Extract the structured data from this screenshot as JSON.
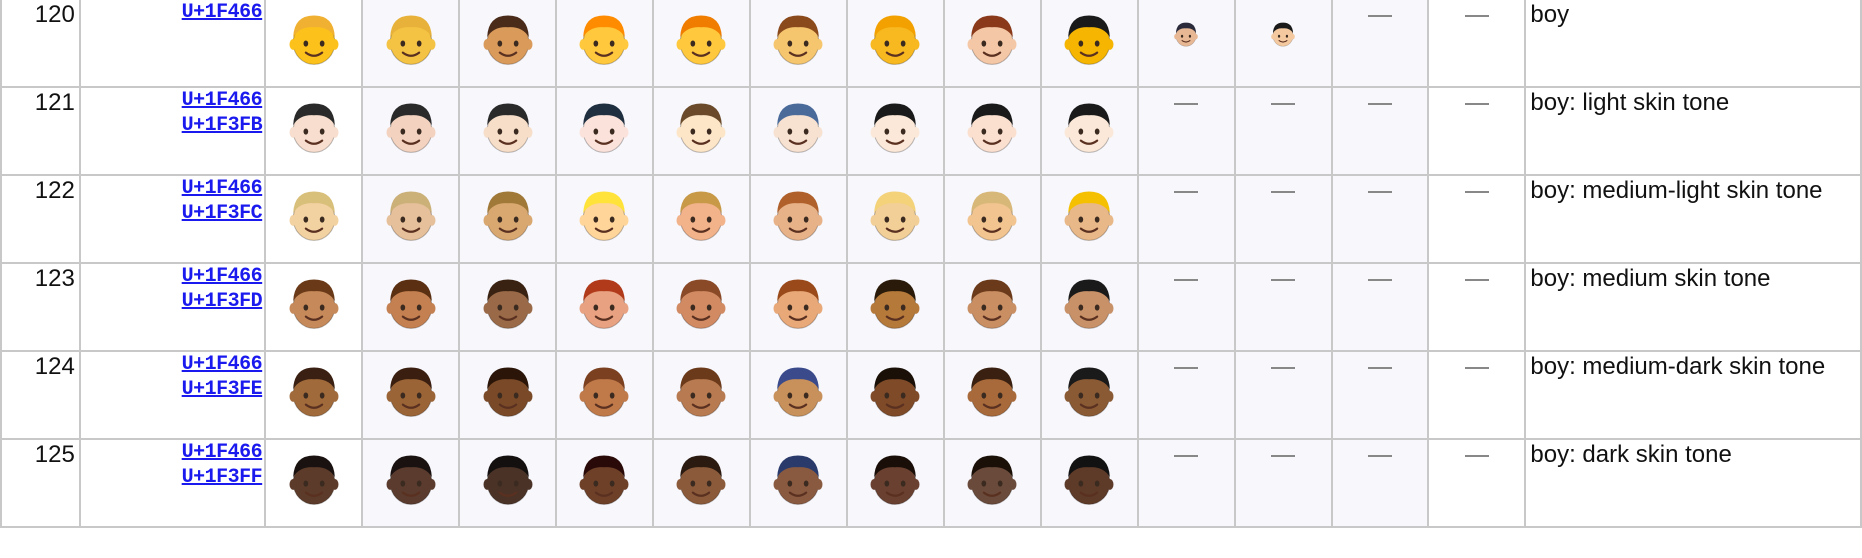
{
  "columns": {
    "count": 15,
    "shaded": [
      3,
      4,
      5,
      6,
      7,
      8,
      9,
      10,
      11,
      12,
      13
    ]
  },
  "rows": [
    {
      "num": "120",
      "codes": [
        "U+1F466"
      ],
      "name": "boy",
      "skin": "#fcc21b",
      "hair": "#f4b43c",
      "skins": [
        "#fcc21b",
        "#f5c343",
        "#d99a5a",
        "#ffc83d",
        "#ffc83d",
        "#f6c66e",
        "#f8b820",
        "#f4c7a6",
        "#f5b500"
      ],
      "hairs": [
        "#f0b032",
        "#e8b23a",
        "#4a2a18",
        "#ff8c00",
        "#f07c00",
        "#8a4a1c",
        "#f2a100",
        "#8a3a1a",
        "#1a1a1a"
      ],
      "small": true
    },
    {
      "num": "121",
      "codes": [
        "U+1F466",
        "U+1F3FB"
      ],
      "name": "boy: light skin tone",
      "skins": [
        "#f7dece",
        "#f3d2bf",
        "#f7dec8",
        "#fbe3dc",
        "#fde6c8",
        "#f7e1d0",
        "#fbe8d8",
        "#fbe0d0",
        "#fbe8d8"
      ],
      "hairs": [
        "#2a2a2a",
        "#2a2a2a",
        "#2a2a2a",
        "#1f2f3f",
        "#6a4a2a",
        "#4a6a9a",
        "#1a1a1a",
        "#1a1a1a",
        "#1a1a1a"
      ],
      "small": false
    },
    {
      "num": "122",
      "codes": [
        "U+1F466",
        "U+1F3FC"
      ],
      "name": "boy: medium-light skin tone",
      "skins": [
        "#f3d2a2",
        "#e6c09a",
        "#d9a870",
        "#ffd59a",
        "#f2b28a",
        "#e8b288",
        "#f3cf98",
        "#f1c490",
        "#e9b888"
      ],
      "hairs": [
        "#d8bf7a",
        "#cbb078",
        "#a07838",
        "#ffe23a",
        "#c89a48",
        "#b0602a",
        "#f3d27a",
        "#d8b878",
        "#f5c000"
      ],
      "small": false
    },
    {
      "num": "123",
      "codes": [
        "U+1F466",
        "U+1F3FD"
      ],
      "name": "boy: medium skin tone",
      "skins": [
        "#c68a5a",
        "#c48050",
        "#9a6a48",
        "#e8a282",
        "#d28a62",
        "#e8a878",
        "#b5793a",
        "#c98e62",
        "#c99168"
      ],
      "hairs": [
        "#6a3a18",
        "#5a2f12",
        "#3a2212",
        "#b03a1a",
        "#8a4a28",
        "#9a4a1a",
        "#2a1a0a",
        "#6a3a1a",
        "#1a1a1a"
      ],
      "small": false
    },
    {
      "num": "124",
      "codes": [
        "U+1F466",
        "U+1F3FE"
      ],
      "name": "boy: medium-dark skin tone",
      "skins": [
        "#a06a3a",
        "#9a6436",
        "#7a4a28",
        "#c07a4a",
        "#b87a50",
        "#c8905a",
        "#7e4a28",
        "#a86a3a",
        "#8a5a34"
      ],
      "hairs": [
        "#3a2012",
        "#3a1f10",
        "#2a1508",
        "#7a4020",
        "#6a3a1a",
        "#3a4a8a",
        "#1a1008",
        "#3a2010",
        "#1a1a1a"
      ],
      "small": false
    },
    {
      "num": "125",
      "codes": [
        "U+1F466",
        "U+1F3FF"
      ],
      "name": "boy: dark skin tone",
      "skins": [
        "#5c3b2a",
        "#5a3b2e",
        "#4a3226",
        "#6e4028",
        "#8a5a3a",
        "#8a5a40",
        "#6a4030",
        "#6a4a3a",
        "#5e3a28"
      ],
      "hairs": [
        "#1a1210",
        "#1a1210",
        "#141010",
        "#2a0a08",
        "#2a1a10",
        "#2a3a6a",
        "#1a0e08",
        "#1a1008",
        "#121212"
      ],
      "small": false
    }
  ]
}
